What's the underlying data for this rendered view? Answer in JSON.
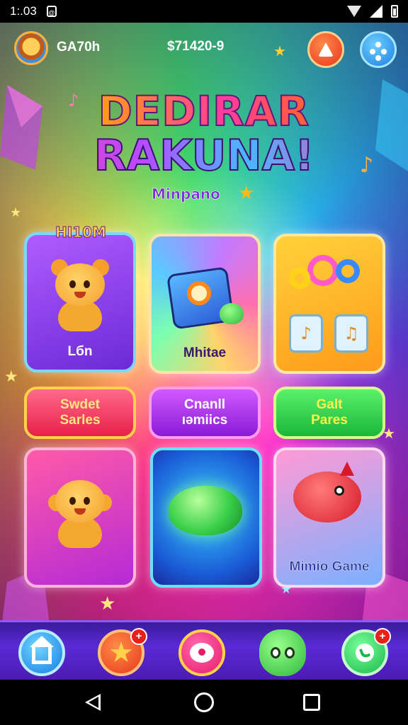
{
  "status_bar": {
    "time": "1:.03",
    "sim_label": "@"
  },
  "header": {
    "player_name": "GA70h",
    "coins": "$71420-9"
  },
  "title": {
    "line1": "DEDIRAR",
    "line2": "RAKUNA!",
    "subtitle": "Minpano"
  },
  "section": {
    "label": "HI10M"
  },
  "game_cards": [
    {
      "label": "Lбn"
    },
    {
      "label": "Mhitae"
    },
    {
      "label": ""
    },
    {
      "label": ""
    },
    {
      "label": ""
    },
    {
      "label": "Mimio Game"
    }
  ],
  "categories": [
    {
      "line1": "Swdet",
      "line2": "Sarles"
    },
    {
      "line1": "Cnanll",
      "line2": "ıəmiics"
    },
    {
      "line1": "Galt",
      "line2": "Pares"
    }
  ],
  "bottom_nav": [
    {
      "icon": "home-icon"
    },
    {
      "icon": "star-icon",
      "badge": "+"
    },
    {
      "icon": "chat-icon"
    },
    {
      "icon": "monster-icon"
    },
    {
      "icon": "phone-icon",
      "badge": "+"
    }
  ],
  "colors": {
    "accent_orange": "#e8361b",
    "accent_blue": "#1c7fe0",
    "nav_bar": "#5a2ad6"
  }
}
